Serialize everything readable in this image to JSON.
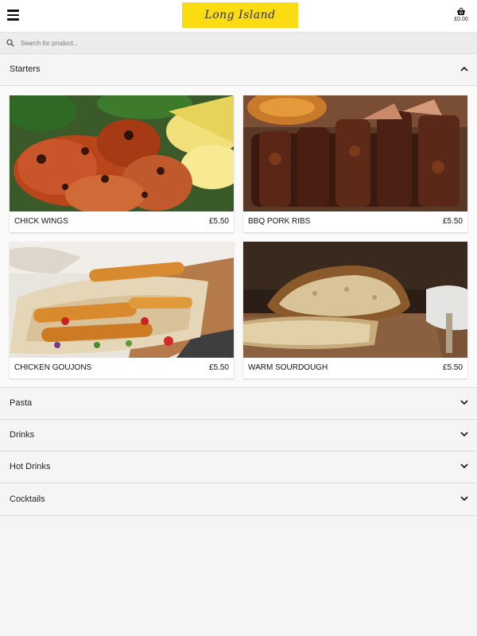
{
  "header": {
    "menu_icon": "hamburger-menu-icon",
    "logo_text": "Long Island",
    "logo_color": "#fbdc12",
    "basket_icon": "shopping-basket-icon",
    "basket_total": "£0.00"
  },
  "search": {
    "icon": "search-icon",
    "placeholder": "Search for product..."
  },
  "categories": [
    {
      "label": "Starters",
      "expanded": true,
      "chevron": "chevron-up-icon"
    },
    {
      "label": "Pasta",
      "expanded": false,
      "chevron": "chevron-down-icon"
    },
    {
      "label": "Drinks",
      "expanded": false,
      "chevron": "chevron-down-icon"
    },
    {
      "label": "Hot Drinks",
      "expanded": false,
      "chevron": "chevron-down-icon"
    },
    {
      "label": "Cocktails",
      "expanded": false,
      "chevron": "chevron-down-icon"
    }
  ],
  "products": [
    {
      "name": "CHICK WINGS",
      "price": "£5.50"
    },
    {
      "name": "BBQ PORK RIBS",
      "price": "£5.50"
    },
    {
      "name": "CHICKEN GOUJONS",
      "price": "£5.50"
    },
    {
      "name": "WARM SOURDOUGH",
      "price": "£5.50"
    }
  ]
}
